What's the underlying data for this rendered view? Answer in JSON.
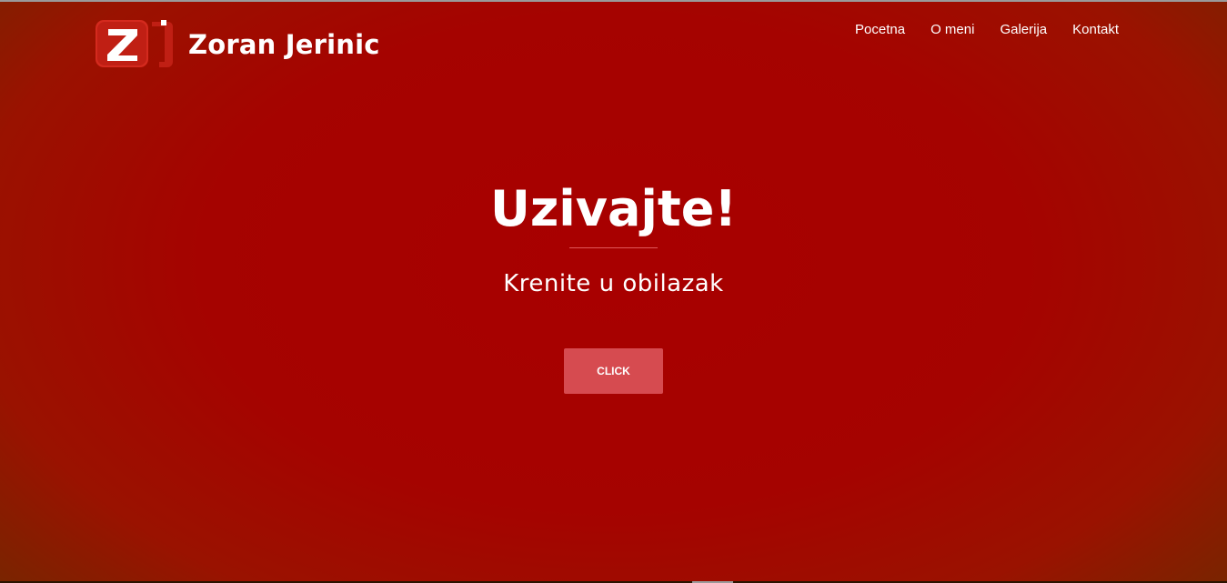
{
  "header": {
    "brand_name": "Zoran Jerinic",
    "logo_icon": "zj-logo-icon"
  },
  "nav": {
    "items": [
      {
        "label": "Pocetna"
      },
      {
        "label": "O meni"
      },
      {
        "label": "Galerija"
      },
      {
        "label": "Kontakt"
      }
    ]
  },
  "hero": {
    "title": "Uzivajte!",
    "subtitle": "Krenite u obilazak",
    "button_label": "CLICK"
  },
  "colors": {
    "background": "#a80000",
    "button": "#d64b50",
    "divider": "#e2585a",
    "text": "#ffffff"
  }
}
